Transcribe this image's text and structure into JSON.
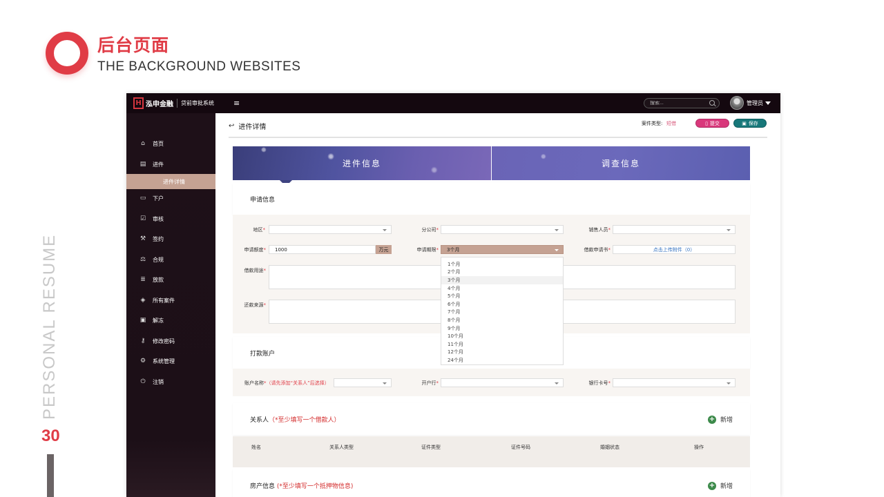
{
  "slide": {
    "title": "后台页面",
    "subtitle": "THE BACKGROUND WEBSITES",
    "vertical_text": "PERSONAL RESUME",
    "page_number": "30"
  },
  "topbar": {
    "logo_text": "泓申金融",
    "system_name": "贷前审批系统",
    "menu_icon": "≡",
    "search_placeholder": "搜索...",
    "user_name": "管理员"
  },
  "sidebar": {
    "items": [
      {
        "label": "首页",
        "icon": "home-icon"
      },
      {
        "label": "进件",
        "icon": "document-icon"
      },
      {
        "label": "下户",
        "icon": "inbox-icon"
      },
      {
        "label": "审核",
        "icon": "check-square-icon"
      },
      {
        "label": "签约",
        "icon": "gavel-icon"
      },
      {
        "label": "合规",
        "icon": "scale-icon"
      },
      {
        "label": "放款",
        "icon": "money-list-icon"
      },
      {
        "label": "所有案件",
        "icon": "layers-icon"
      },
      {
        "label": "解冻",
        "icon": "unlock-icon"
      },
      {
        "label": "修改密码",
        "icon": "key-icon"
      },
      {
        "label": "系统管理",
        "icon": "gear-icon"
      },
      {
        "label": "注销",
        "icon": "power-icon"
      }
    ],
    "active_sub": "进件详情"
  },
  "header": {
    "title": "进件详情",
    "case_type_label": "案件类型:",
    "case_type_value": "短借",
    "submit_label": "提交",
    "save_label": "保存"
  },
  "tabs": [
    "进件信息",
    "调查信息"
  ],
  "application": {
    "section_title": "申请信息",
    "region_label": "地区",
    "branch_label": "分公司",
    "sales_label": "销售人员",
    "amount_label": "申请额度",
    "amount_value": "1000",
    "amount_unit": "万元",
    "term_label": "申请期限",
    "term_value": "3个月",
    "loan_doc_label": "借款申请书",
    "upload_label": "点击上传附件（0）",
    "purpose_label": "借款用途",
    "repay_label": "还款来源",
    "term_options": [
      "1个月",
      "2个月",
      "3个月",
      "4个月",
      "5个月",
      "6个月",
      "7个月",
      "8个月",
      "9个月",
      "10个月",
      "11个月",
      "12个月",
      "24个月"
    ]
  },
  "account": {
    "section_title": "打款账户",
    "account_name_label": "账户名称",
    "account_name_hint": "（请先添加“关系人”后选择）",
    "bank_label": "开户行",
    "card_label": "银行卡号"
  },
  "contacts": {
    "section_title": "关系人",
    "hint": "（*至少填写一个借款人）",
    "add_label": "新增",
    "columns": [
      "姓名",
      "关系人类型",
      "证件类型",
      "证件号码",
      "婚姻状态",
      "操作"
    ]
  },
  "property": {
    "section_title": "房产信息",
    "hint": "(*至少填写一个抵押物信息)",
    "add_label": "新增"
  }
}
